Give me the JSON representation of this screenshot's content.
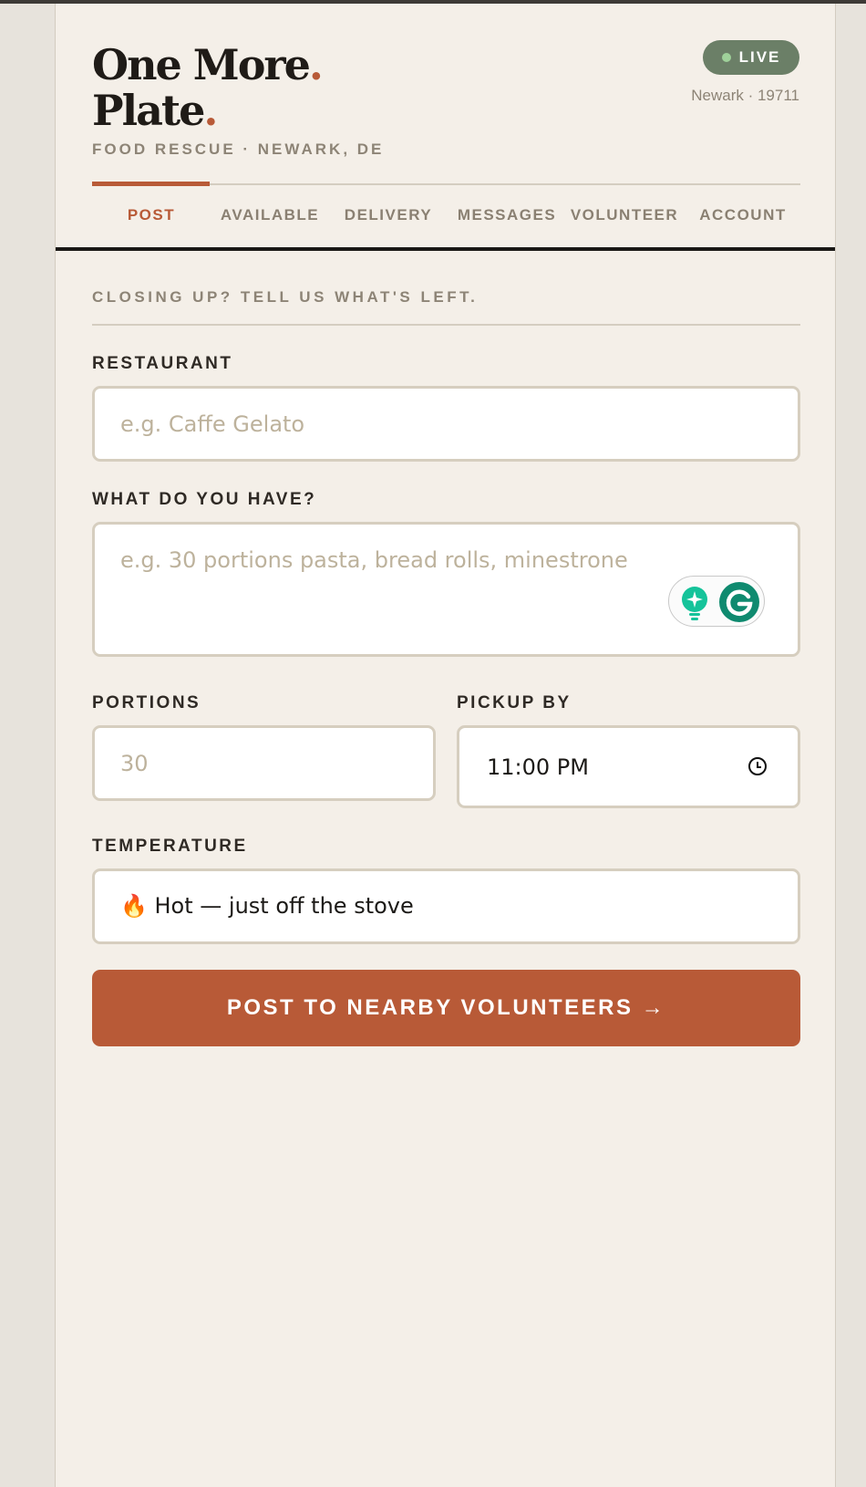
{
  "brand": {
    "name_line1": "One More",
    "name_line2": "Plate",
    "dot": ".",
    "tagline": "FOOD RESCUE · NEWARK, DE"
  },
  "status": {
    "badge": "LIVE",
    "location": "Newark · 19711"
  },
  "nav": {
    "tabs": [
      {
        "label": "POST",
        "active": true
      },
      {
        "label": "AVAILABLE",
        "active": false
      },
      {
        "label": "DELIVERY",
        "active": false
      },
      {
        "label": "MESSAGES",
        "active": false
      },
      {
        "label": "VOLUNTEER",
        "active": false
      },
      {
        "label": "ACCOUNT",
        "active": false
      }
    ]
  },
  "form": {
    "section_title": "CLOSING UP? TELL US WHAT'S LEFT.",
    "restaurant": {
      "label": "RESTAURANT",
      "placeholder": "e.g. Caffe Gelato",
      "value": ""
    },
    "items": {
      "label": "WHAT DO YOU HAVE?",
      "placeholder": "e.g. 30 portions pasta, bread rolls, minestrone",
      "value": ""
    },
    "portions": {
      "label": "PORTIONS",
      "placeholder": "30",
      "value": ""
    },
    "pickup": {
      "label": "PICKUP BY",
      "value": "11:00 PM"
    },
    "temperature": {
      "label": "TEMPERATURE",
      "value": "🔥 Hot — just off the stove"
    },
    "submit_label": "POST TO NEARBY VOLUNTEERS →"
  },
  "colors": {
    "accent": "#b85a37",
    "live_badge": "#6b7f67",
    "background": "#f4efe8"
  },
  "icons": [
    "clock-icon",
    "grammarly-bulb-icon",
    "grammarly-g-icon",
    "status-dot-icon"
  ]
}
